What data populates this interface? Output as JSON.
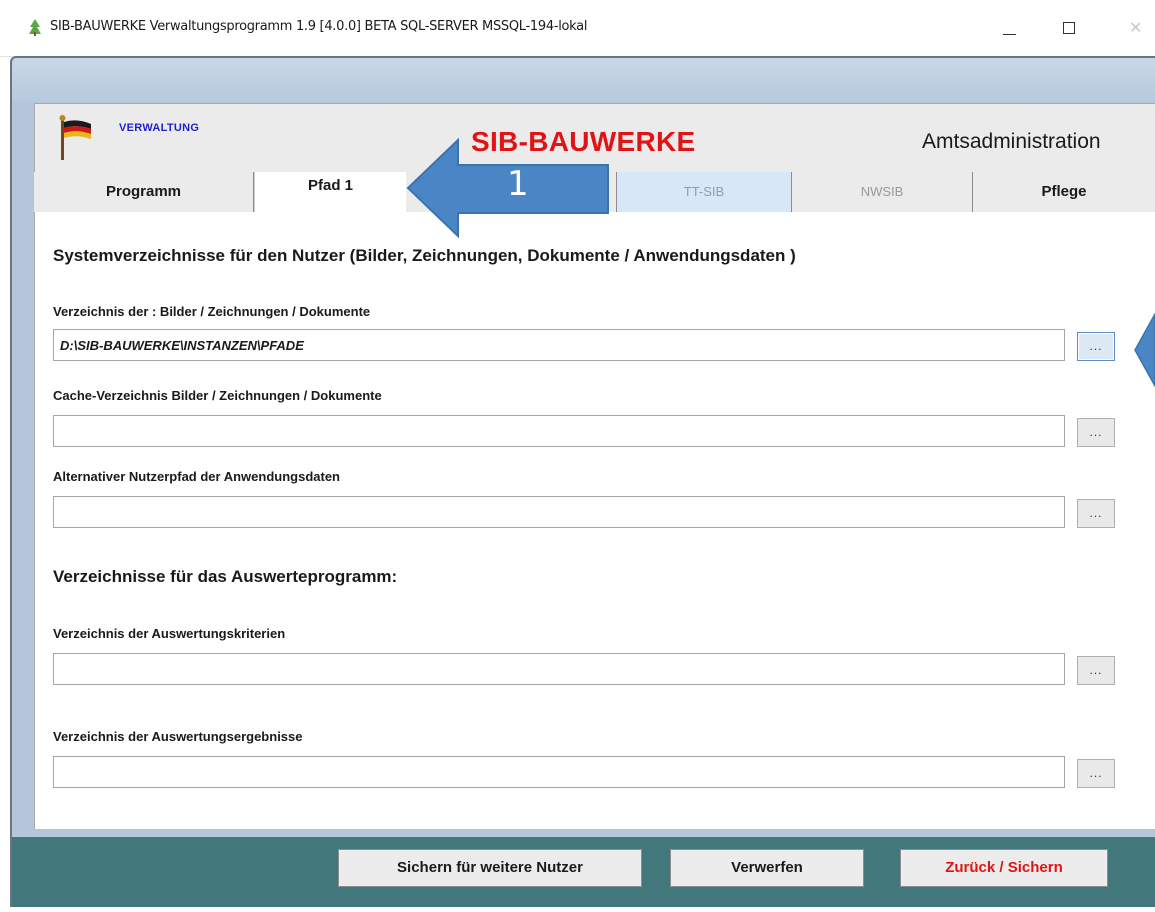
{
  "window": {
    "title": "SIB-BAUWERKE Verwaltungsprogramm 1.9 [4.0.0] BETA SQL-SERVER MSSQL-194-lokal",
    "close_glyph": "✕"
  },
  "header": {
    "section_label": "VERWALTUNG",
    "brand": "SIB-BAUWERKE",
    "role": "Amtsadministration"
  },
  "tabs": [
    {
      "label": "Programm",
      "state": "normal"
    },
    {
      "label": "Pfad 1",
      "state": "active"
    },
    {
      "label": "TT-SIB",
      "state": "disabled"
    },
    {
      "label": "NWSIB",
      "state": "disabled"
    },
    {
      "label": "Pflege",
      "state": "normal"
    }
  ],
  "section1": {
    "heading": "Systemverzeichnisse für den Nutzer (Bilder, Zeichnungen, Dokumente / Anwendungsdaten )",
    "fields": [
      {
        "label": "Verzeichnis der : Bilder / Zeichnungen / Dokumente",
        "value": "D:\\SIB-BAUWERKE\\INSTANZEN\\PFADE",
        "browse": "..."
      },
      {
        "label": "Cache-Verzeichnis Bilder / Zeichnungen / Dokumente",
        "value": "",
        "browse": "..."
      },
      {
        "label": "Alternativer Nutzerpfad der Anwendungsdaten",
        "value": "",
        "browse": "..."
      }
    ]
  },
  "section2": {
    "heading": "Verzeichnisse für das Auswerteprogramm:",
    "fields": [
      {
        "label": "Verzeichnis der Auswertungskriterien",
        "value": "",
        "browse": "..."
      },
      {
        "label": "Verzeichnis der Auswertungsergebnisse",
        "value": "",
        "browse": "..."
      }
    ]
  },
  "buttons": {
    "save_for_users": "Sichern für weitere Nutzer",
    "discard": "Verwerfen",
    "back_save": "Zurück / Sichern"
  },
  "annotation": {
    "step_number": "1",
    "color": "#4a86c5"
  },
  "colors": {
    "brand_red": "#e01414",
    "frame_teal": "#42787c",
    "frame_blue": "#b4c7da",
    "label_blue": "#1f1fd0"
  }
}
